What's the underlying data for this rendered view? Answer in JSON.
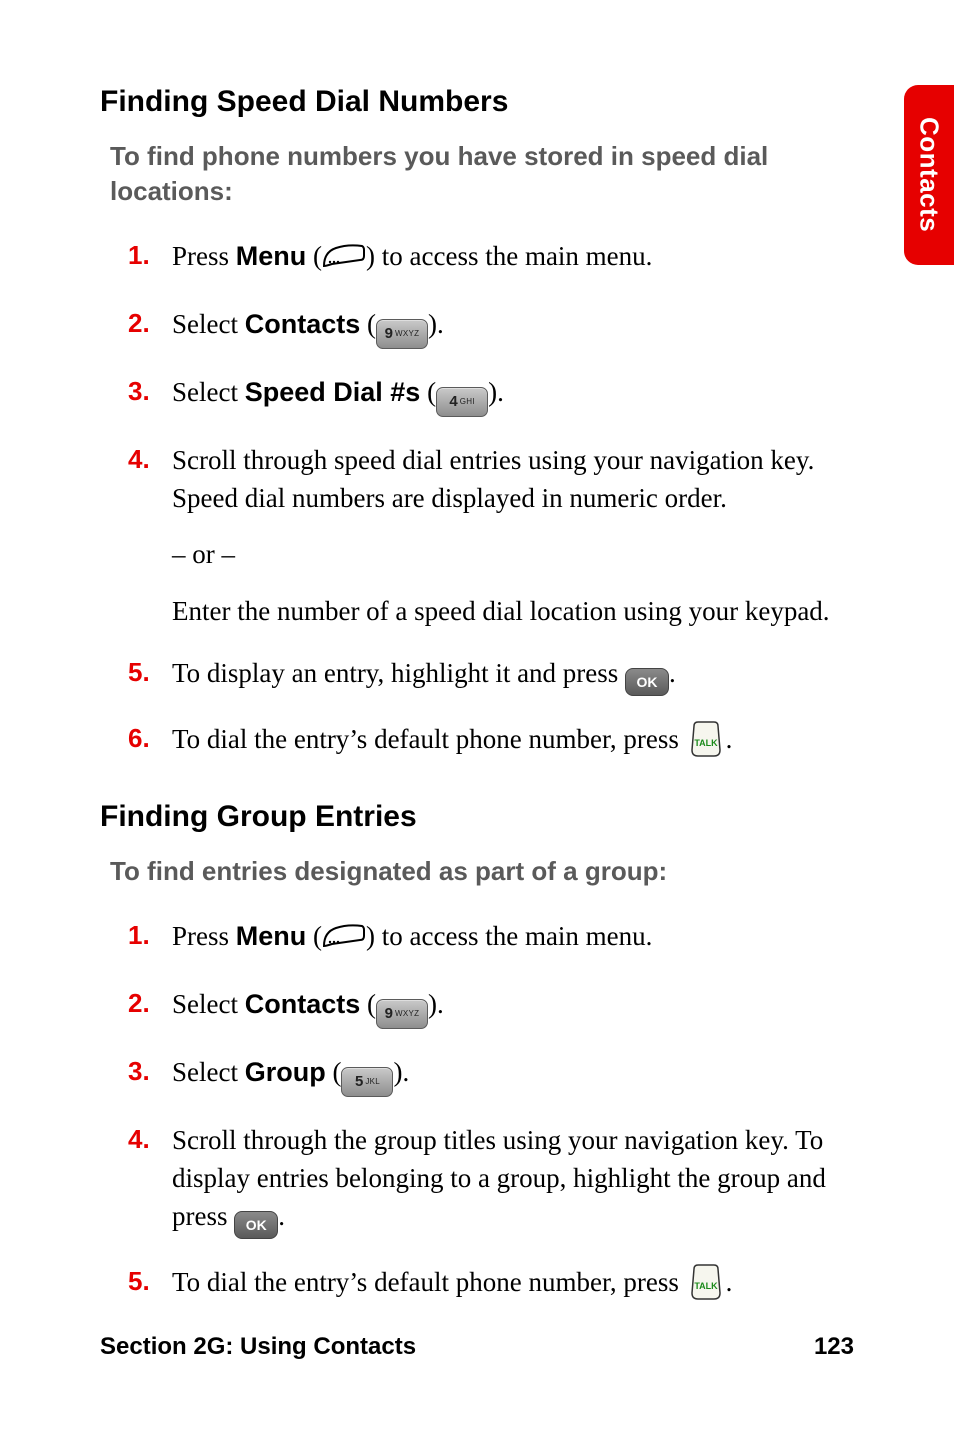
{
  "side_tab": "Contacts",
  "section1": {
    "heading": "Finding Speed Dial Numbers",
    "intro": "To find phone numbers you have stored in speed dial locations:",
    "steps": {
      "s1_num": "1.",
      "s1_a": "Press ",
      "s1_menu": "Menu",
      "s1_b": " (",
      "s1_c": ") to access the main menu.",
      "s2_num": "2.",
      "s2_a": "Select ",
      "s2_contacts": "Contacts",
      "s2_b": " (",
      "s2_c": ").",
      "s3_num": "3.",
      "s3_a": "Select ",
      "s3_speed": "Speed Dial #s",
      "s3_b": " (",
      "s3_c": ").",
      "s4_num": "4.",
      "s4_a": "Scroll through speed dial entries using your navigation key. Speed dial numbers are displayed in numeric order.",
      "s4_or": "– or –",
      "s4_b": "Enter the number of a speed dial location using your keypad.",
      "s5_num": "5.",
      "s5_a": "To display an entry, highlight it and press ",
      "s5_b": ".",
      "s6_num": "6.",
      "s6_a": "To dial the entry’s default phone number, press ",
      "s6_b": "."
    }
  },
  "section2": {
    "heading": "Finding Group Entries",
    "intro": "To find entries designated as part of a group:",
    "steps": {
      "s1_num": "1.",
      "s1_a": "Press ",
      "s1_menu": "Menu",
      "s1_b": " (",
      "s1_c": ") to access the main menu.",
      "s2_num": "2.",
      "s2_a": "Select ",
      "s2_contacts": "Contacts",
      "s2_b": " (",
      "s2_c": ").",
      "s3_num": "3.",
      "s3_a": "Select ",
      "s3_group": "Group",
      "s3_b": " (",
      "s3_c": ").",
      "s4_num": "4.",
      "s4_a": "Scroll through the group titles using your navigation key. To display entries belonging to a group, highlight the group and press ",
      "s4_b": ".",
      "s5_num": "5.",
      "s5_a": "To dial the entry’s default phone number, press ",
      "s5_b": "."
    }
  },
  "keys": {
    "key9_digit": "9",
    "key9_letters": "WXYZ",
    "key4_digit": "4",
    "key4_letters": "GHI",
    "key5_digit": "5",
    "key5_letters": "JKL",
    "ok": "OK"
  },
  "footer": {
    "left": "Section 2G: Using Contacts",
    "right": "123"
  }
}
